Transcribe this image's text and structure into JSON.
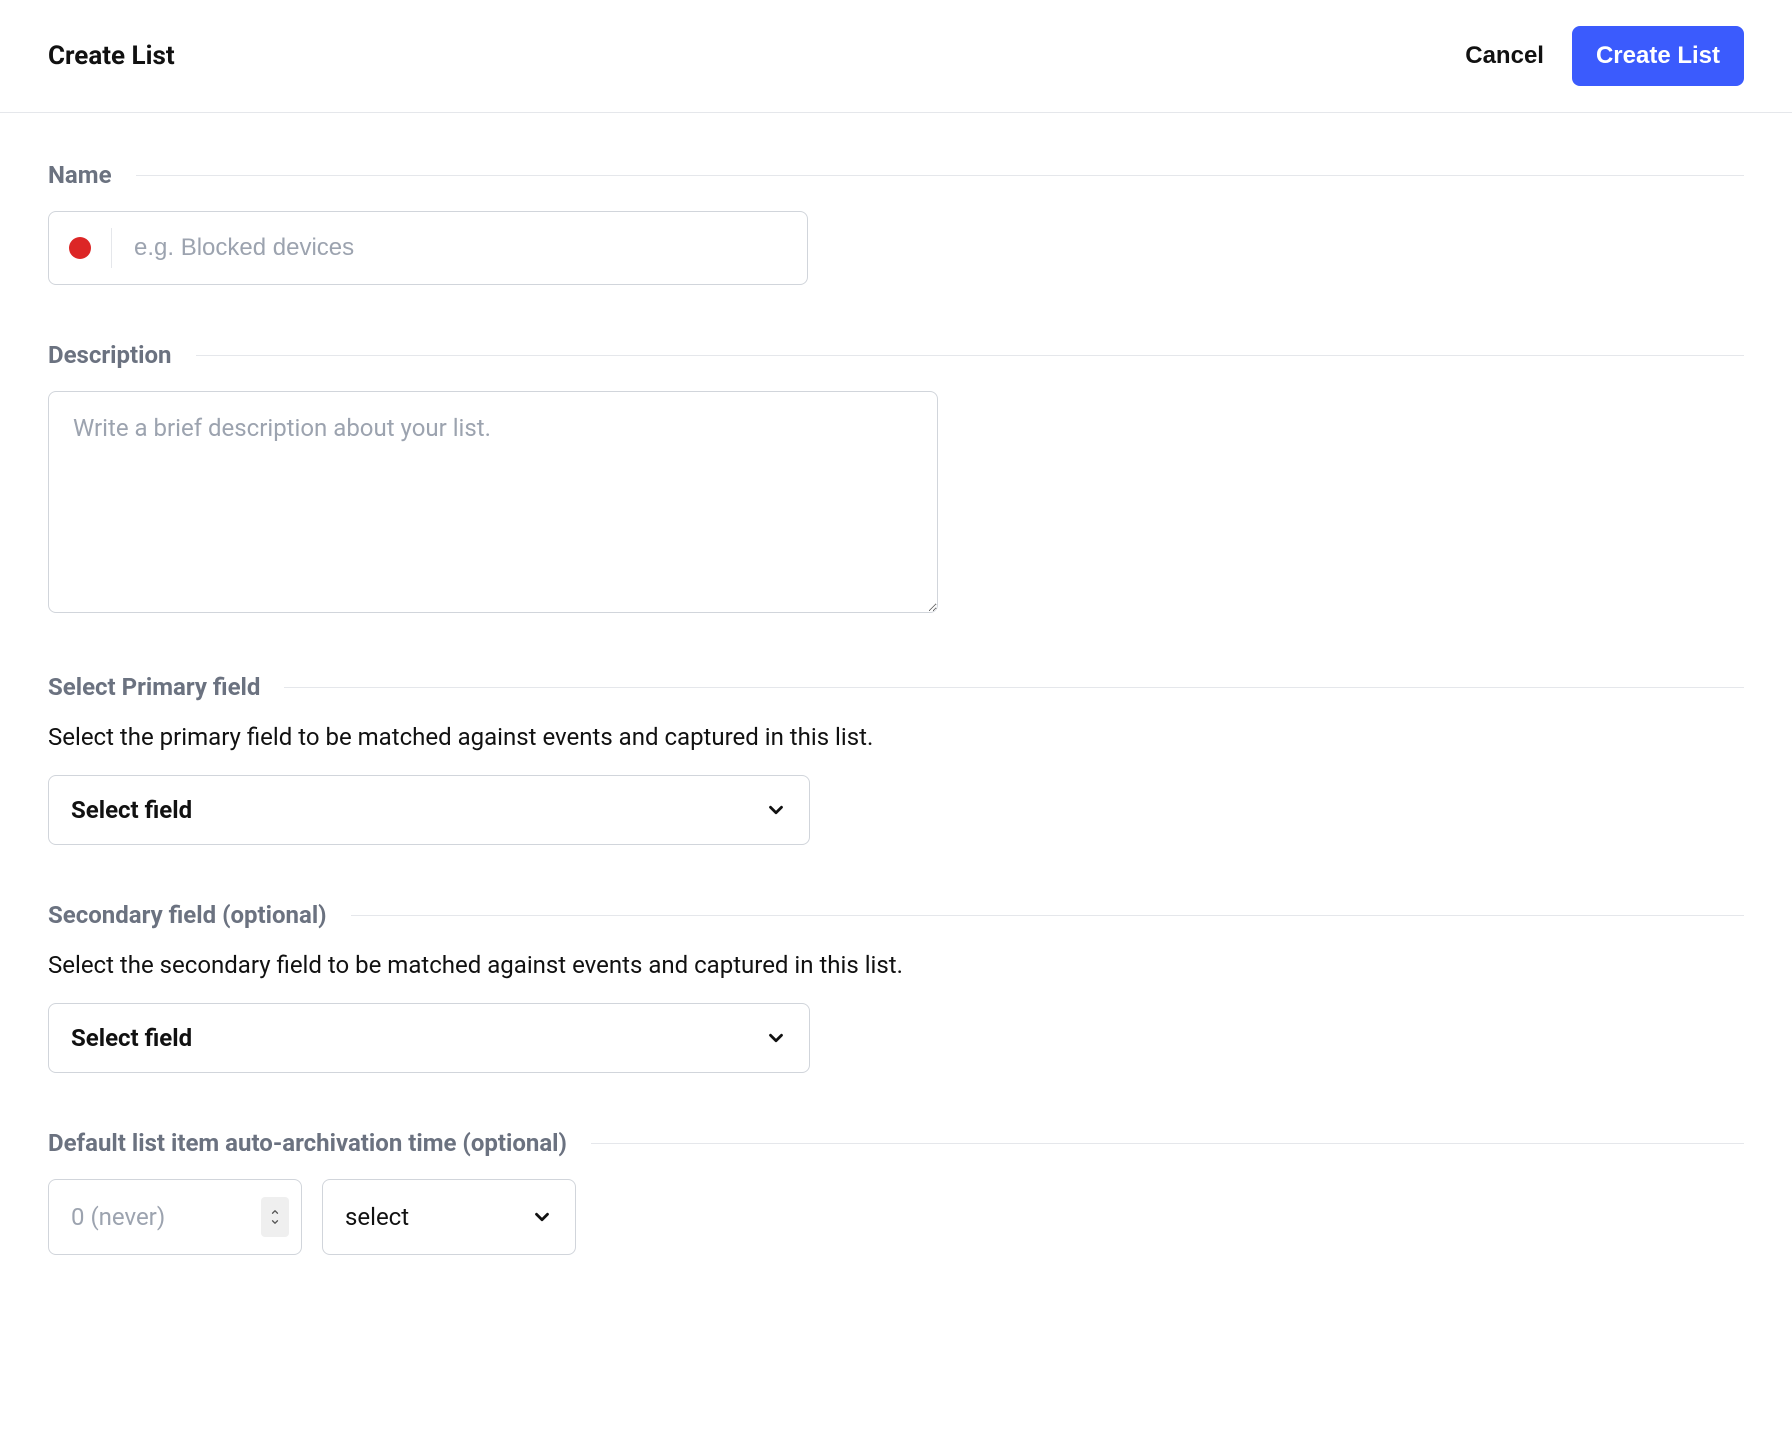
{
  "header": {
    "title": "Create List",
    "cancel_label": "Cancel",
    "submit_label": "Create List"
  },
  "sections": {
    "name": {
      "title": "Name",
      "placeholder": "e.g. Blocked devices",
      "color": "#dc2626"
    },
    "description": {
      "title": "Description",
      "placeholder": "Write a brief description about your list."
    },
    "primary_field": {
      "title": "Select Primary field",
      "help": "Select the primary field to be matched against events and captured in this list.",
      "select_label": "Select field"
    },
    "secondary_field": {
      "title": "Secondary field (optional)",
      "help": "Select the secondary field to be matched against events and captured in this list.",
      "select_label": "Select field"
    },
    "archive": {
      "title": "Default list item auto-archivation time (optional)",
      "number_placeholder": "0 (never)",
      "unit_label": "select"
    }
  }
}
